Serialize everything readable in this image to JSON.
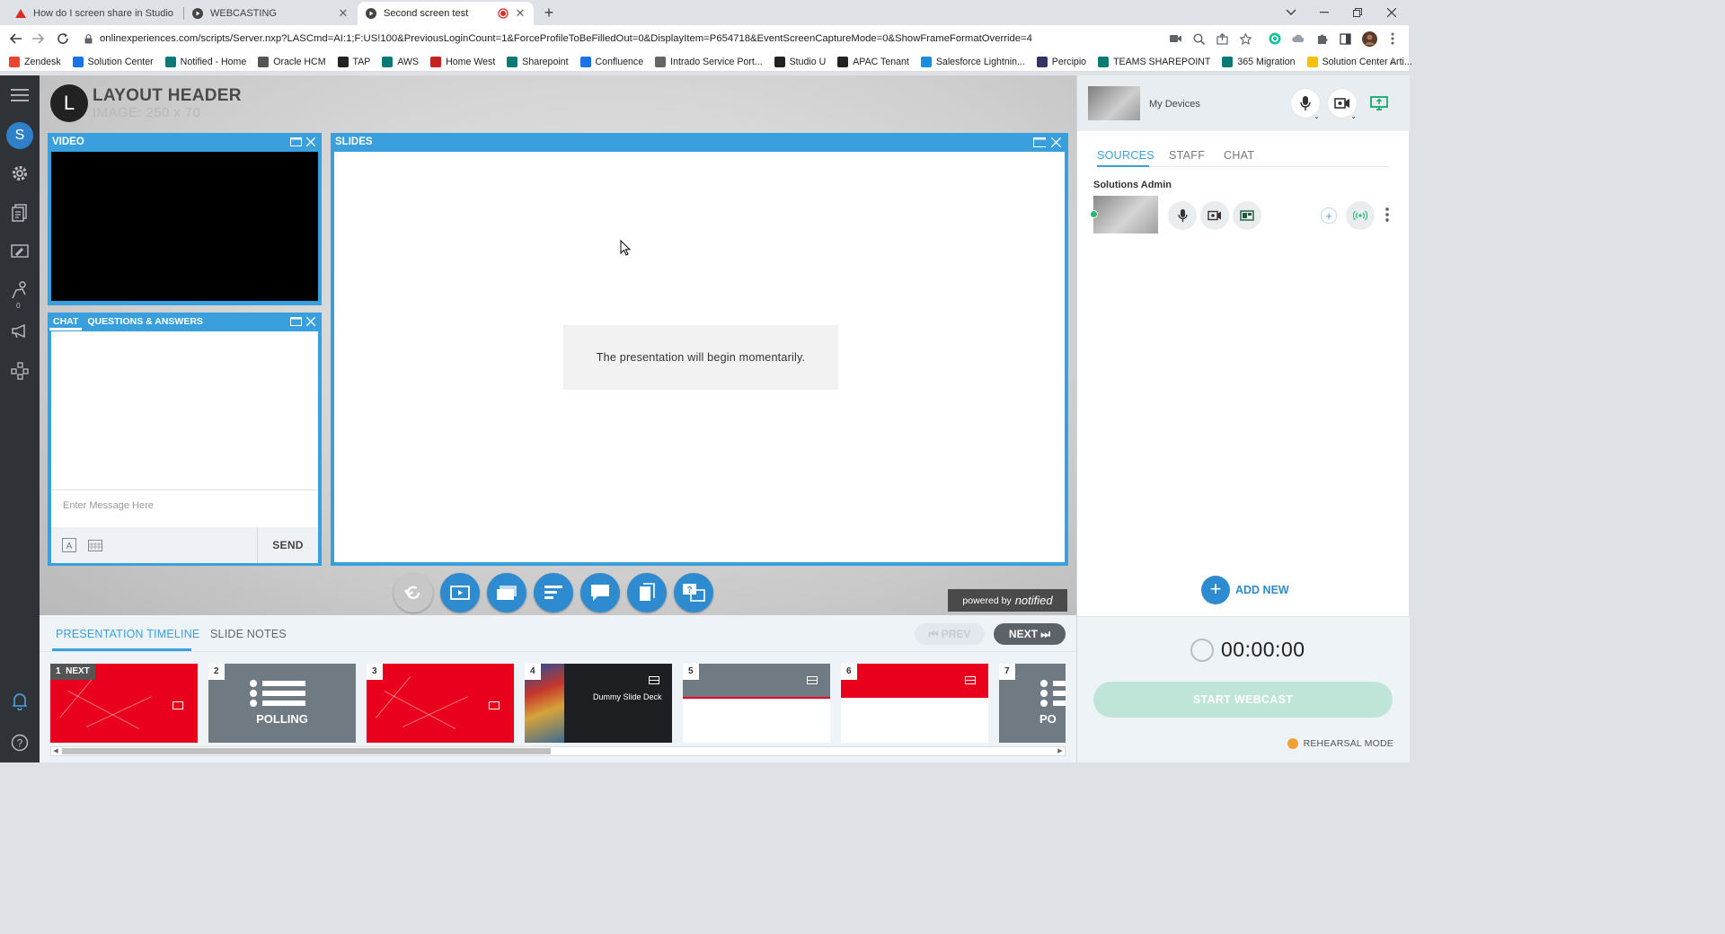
{
  "browser": {
    "tabs": [
      {
        "title": "How do I screen share in Studio",
        "favicon": "notified-logo-icon",
        "active": false
      },
      {
        "title": "WEBCASTING",
        "favicon": "studio-play-icon",
        "active": false
      },
      {
        "title": "Second screen test",
        "favicon": "studio-play-icon",
        "active": true
      }
    ],
    "new_tab": "+",
    "url": "onlinexperiences.com/scripts/Server.nxp?LASCmd=AI:1;F:US!100&PreviousLoginCount=1&ForceProfileToBeFilledOut=0&DisplayItem=P654718&EventScreenCaptureMode=0&ShowFrameFormatOverride=4",
    "bookmarks": [
      {
        "label": "Zendesk",
        "color": "#ea4335"
      },
      {
        "label": "Solution Center",
        "color": "#1a73e8"
      },
      {
        "label": "Notified - Home",
        "color": "#0b7a75"
      },
      {
        "label": "Oracle HCM",
        "color": "#555555"
      },
      {
        "label": "TAP",
        "color": "#222222"
      },
      {
        "label": "AWS",
        "color": "#0b7a75"
      },
      {
        "label": "Home West",
        "color": "#c5221f"
      },
      {
        "label": "Sharepoint",
        "color": "#0b7a75"
      },
      {
        "label": "Confluence",
        "color": "#1a73e8"
      },
      {
        "label": "Intrado Service Port...",
        "color": "#666666"
      },
      {
        "label": "Studio U",
        "color": "#222222"
      },
      {
        "label": "APAC Tenant",
        "color": "#222222"
      },
      {
        "label": "Salesforce Lightnin...",
        "color": "#1a8ed8"
      },
      {
        "label": "Percipio",
        "color": "#333366"
      },
      {
        "label": "TEAMS SHAREPOINT",
        "color": "#0b7a75"
      },
      {
        "label": "365 Migration",
        "color": "#0b7a75"
      },
      {
        "label": "Solution Center Arti...",
        "color": "#f4c20d"
      }
    ],
    "bookmarks_more": "»"
  },
  "nav": {
    "avatar_letter": "S",
    "notification_count": "0"
  },
  "header": {
    "logo_letter": "L",
    "title": "LAYOUT HEADER",
    "subtitle": "IMAGE: 250 x 70"
  },
  "video_panel": {
    "title": "VIDEO"
  },
  "slides_panel": {
    "title": "SLIDES",
    "message": "The presentation will begin momentarily."
  },
  "chat_panel": {
    "tabs": [
      "CHAT",
      "QUESTIONS & ANSWERS"
    ],
    "placeholder": "Enter Message Here",
    "send_label": "SEND"
  },
  "powered_by": {
    "prefix": "powered by",
    "brand": "notified"
  },
  "timeline": {
    "tabs": [
      "PRESENTATION TIMELINE",
      "SLIDE NOTES"
    ],
    "prev_label": "PREV",
    "next_label": "NEXT",
    "thumbs": [
      {
        "num": "1",
        "badge": "NEXT",
        "kind": "red"
      },
      {
        "num": "2",
        "kind": "polling",
        "label": "POLLING"
      },
      {
        "num": "3",
        "kind": "red"
      },
      {
        "num": "4",
        "kind": "deck",
        "label": "Dummy Slide Deck"
      },
      {
        "num": "5",
        "kind": "grey-white"
      },
      {
        "num": "6",
        "kind": "red-white"
      },
      {
        "num": "7",
        "kind": "polling",
        "label": "PO"
      }
    ]
  },
  "right_panel": {
    "devices_label": "My Devices",
    "tabs": [
      "SOURCES",
      "STAFF",
      "CHAT"
    ],
    "source_name": "Solutions Admin",
    "add_new_label": "ADD NEW",
    "timer": "00:00:00",
    "start_label": "START WEBCAST",
    "rehearsal_label": "REHEARSAL MODE"
  },
  "colors": {
    "accent_blue": "#3aa0dd",
    "button_blue": "#2f8bd0",
    "nav_dark": "#2f3338",
    "slide_red": "#e8001c",
    "status_green": "#2bb673",
    "rehearsal_orange": "#f0a136"
  }
}
